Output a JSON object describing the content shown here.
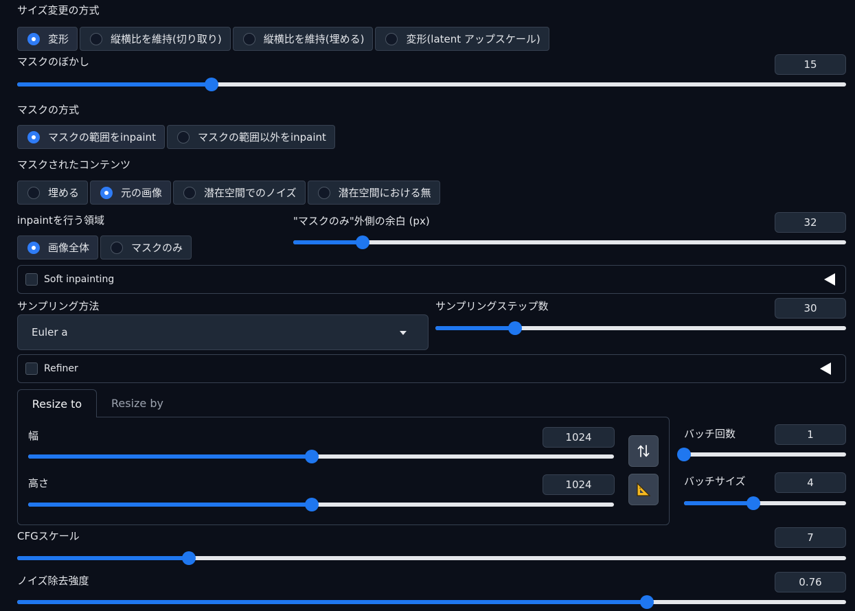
{
  "resize_mode": {
    "label": "サイズ変更の方式",
    "options": [
      "変形",
      "縦横比を維持(切り取り)",
      "縦横比を維持(埋める)",
      "変形(latent アップスケール)"
    ],
    "selected": "変形"
  },
  "mask_blur": {
    "label": "マスクのぼかし",
    "value": "15",
    "min": 0,
    "max": 64
  },
  "mask_mode": {
    "label": "マスクの方式",
    "options": [
      "マスクの範囲をinpaint",
      "マスクの範囲以外をinpaint"
    ],
    "selected": "マスクの範囲をinpaint"
  },
  "masked_content": {
    "label": "マスクされたコンテンツ",
    "options": [
      "埋める",
      "元の画像",
      "潜在空間でのノイズ",
      "潜在空間における無"
    ],
    "selected": "元の画像"
  },
  "inpaint_area": {
    "label": "inpaintを行う領域",
    "options": [
      "画像全体",
      "マスクのみ"
    ],
    "selected": "画像全体"
  },
  "only_masked_padding": {
    "label": "\"マスクのみ\"外側の余白 (px)",
    "value": "32",
    "min": 0,
    "max": 256
  },
  "soft_inpainting": {
    "label": "Soft inpainting",
    "checked": false
  },
  "sampling_method": {
    "label": "サンプリング方法",
    "value": "Euler a"
  },
  "sampling_steps": {
    "label": "サンプリングステップ数",
    "value": "30",
    "min": 1,
    "max": 150
  },
  "refiner": {
    "label": "Refiner",
    "checked": false
  },
  "resize_tabs": {
    "active": "Resize to",
    "inactive": "Resize by"
  },
  "width": {
    "label": "幅",
    "value": "1024",
    "min": 64,
    "max": 2048
  },
  "height": {
    "label": "高さ",
    "value": "1024",
    "min": 64,
    "max": 2048
  },
  "batch_count": {
    "label": "バッチ回数",
    "value": "1",
    "min": 1,
    "max": 100
  },
  "batch_size": {
    "label": "バッチサイズ",
    "value": "4",
    "min": 1,
    "max": 8
  },
  "cfg_scale": {
    "label": "CFGスケール",
    "value": "7",
    "min": 1,
    "max": 30
  },
  "denoising_strength": {
    "label": "ノイズ除去強度",
    "value": "0.76",
    "min": 0,
    "max": 1
  },
  "icons": {
    "swap": "swap-dimensions-icon",
    "ruler": "aspect-ratio-ruler-icon",
    "dropdown": "caret-down-icon",
    "collapse": "triangle-left-icon"
  },
  "colors": {
    "accent": "#1f77f0",
    "background": "#0b0f19",
    "panel": "#1f2937"
  }
}
